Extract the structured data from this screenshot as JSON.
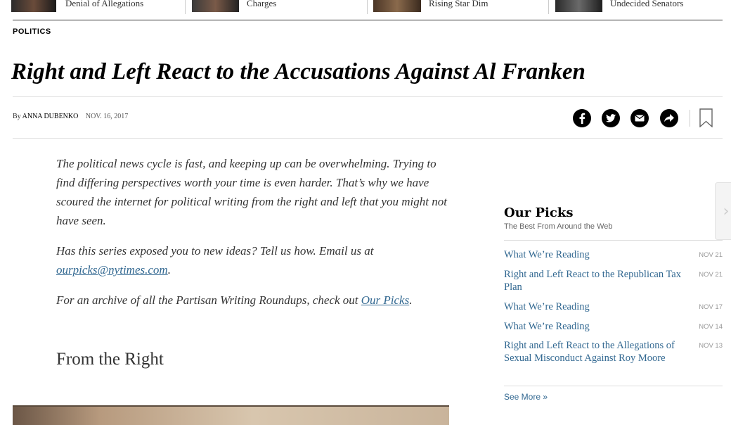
{
  "top_strip": [
    {
      "text": "Denial of Allegations"
    },
    {
      "text": "Charges"
    },
    {
      "text": "Rising Star Dim"
    },
    {
      "text": "Undecided Senators"
    }
  ],
  "article": {
    "section": "POLITICS",
    "headline": "Right and Left React to the Accusations Against Al Franken",
    "byline_prefix": "By",
    "author": "ANNA DUBENKO",
    "date": "NOV. 16, 2017",
    "intro": "The political news cycle is fast, and keeping up can be overwhelming. Trying to find differing perspectives worth your time is even harder. That’s why we have scoured the internet for political writing from the right and left that you might not have seen.",
    "series_prompt": "Has this series exposed you to new ideas? Tell us how. Email us at ",
    "email_link": "ourpicks@nytimes.com",
    "period": ".",
    "archive_prompt": "For an archive of all the Partisan Writing Roundups, check out ",
    "archive_link": "Our Picks",
    "section_heading": "From the Right"
  },
  "share_icons": [
    "facebook-icon",
    "twitter-icon",
    "email-icon",
    "share-icon",
    "bookmark-icon"
  ],
  "sidebar": {
    "title": "Our Picks",
    "subtitle": "The Best From Around the Web",
    "items": [
      {
        "title": "What We’re Reading",
        "date": "NOV 21"
      },
      {
        "title": "Right and Left React to the Republican Tax Plan",
        "date": "NOV 21"
      },
      {
        "title": "What We’re Reading",
        "date": "NOV 17"
      },
      {
        "title": "What We’re Reading",
        "date": "NOV 14"
      },
      {
        "title": "Right and Left React to the Allegations of Sexual Misconduct Against Roy Moore",
        "date": "NOV 13"
      }
    ],
    "see_more": "See More »"
  },
  "colors": {
    "link": "#326891",
    "text": "#333333",
    "headline": "#000000"
  }
}
